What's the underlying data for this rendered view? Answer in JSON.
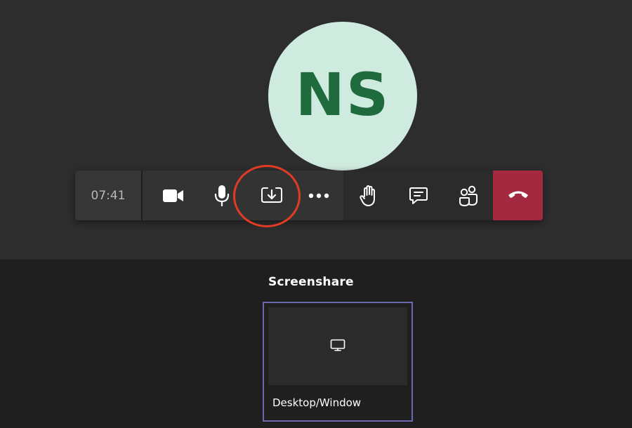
{
  "participant": {
    "initials": "NS"
  },
  "toolbar": {
    "timer": "07:41",
    "buttons": {
      "camera": "camera-icon",
      "microphone": "microphone-icon",
      "share": "share-tray-icon",
      "more": "more-options-icon",
      "raise_hand": "raise-hand-icon",
      "chat": "chat-icon",
      "participants": "participants-icon",
      "hang_up": "hang-up-icon"
    }
  },
  "share_panel": {
    "title": "Screenshare",
    "options": [
      {
        "label": "Desktop/Window",
        "icon": "monitor-icon"
      }
    ]
  },
  "colors": {
    "stage_background": "#2d2d2d",
    "panel_background": "#1f1f1f",
    "avatar_background": "#cfeadf",
    "avatar_text": "#1f6b3e",
    "hang_up": "#a4283f",
    "highlight_ring": "#e23b24",
    "selection_border": "#6b69b0"
  }
}
